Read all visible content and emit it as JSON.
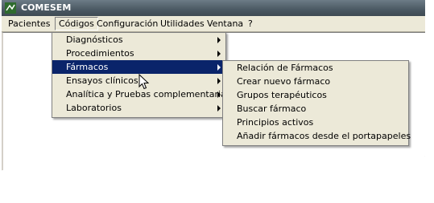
{
  "app": {
    "title": "COMESEM",
    "icon": "app-icon"
  },
  "menubar": {
    "items": [
      {
        "label": "Pacientes"
      },
      {
        "label": "Códigos"
      },
      {
        "label": "Configuración"
      },
      {
        "label": "Utilidades"
      },
      {
        "label": "Ventana"
      },
      {
        "label": "?"
      }
    ],
    "active": "Códigos"
  },
  "codigos_menu": {
    "items": [
      {
        "label": "Diagnósticos",
        "submenu": true
      },
      {
        "label": "Procedimientos",
        "submenu": true
      },
      {
        "label": "Fármacos",
        "submenu": true
      },
      {
        "label": "Ensayos clínicos",
        "submenu": true
      },
      {
        "label": "Analítica y Pruebas complementarias",
        "submenu": true
      },
      {
        "label": "Laboratorios",
        "submenu": true
      }
    ],
    "highlighted": "Fármacos"
  },
  "farmacos_submenu": {
    "items": [
      {
        "label": "Relación de Fármacos"
      },
      {
        "label": "Crear nuevo fármaco"
      },
      {
        "label": "Grupos terapéuticos"
      },
      {
        "label": "Buscar fármaco"
      },
      {
        "label": "Principios activos"
      },
      {
        "label": "Añadir fármacos desde el portapapeles"
      }
    ]
  },
  "colors": {
    "titlebar": "#4b5963",
    "menu_bg": "#ece9d8",
    "highlight": "#0a246a"
  }
}
